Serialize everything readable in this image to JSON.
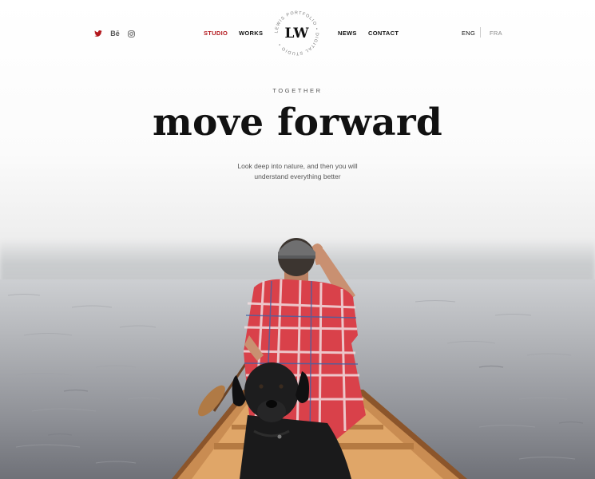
{
  "header": {
    "social": [
      {
        "icon": "twitter-icon",
        "color": "#b3181d"
      },
      {
        "icon": "behance-icon",
        "label": "Bē"
      },
      {
        "icon": "instagram-icon"
      }
    ],
    "nav_left": [
      {
        "label": "STUDIO",
        "active": true
      },
      {
        "label": "WORKS",
        "active": false
      }
    ],
    "nav_right": [
      {
        "label": "NEWS"
      },
      {
        "label": "CONTACT"
      }
    ],
    "logo": {
      "monogram": "LW",
      "ring_text": "LEWIS PORTFOLIO • DIGITAL STUDIO •"
    },
    "languages": [
      {
        "label": "ENG",
        "active": true
      },
      {
        "label": "FRA",
        "active": false
      }
    ]
  },
  "hero": {
    "eyebrow": "TOGETHER",
    "headline": "move forward",
    "subtitle_line1": "Look deep into nature, and then you will",
    "subtitle_line2": "understand everything better"
  },
  "colors": {
    "accent": "#b3181d",
    "text": "#111111"
  }
}
